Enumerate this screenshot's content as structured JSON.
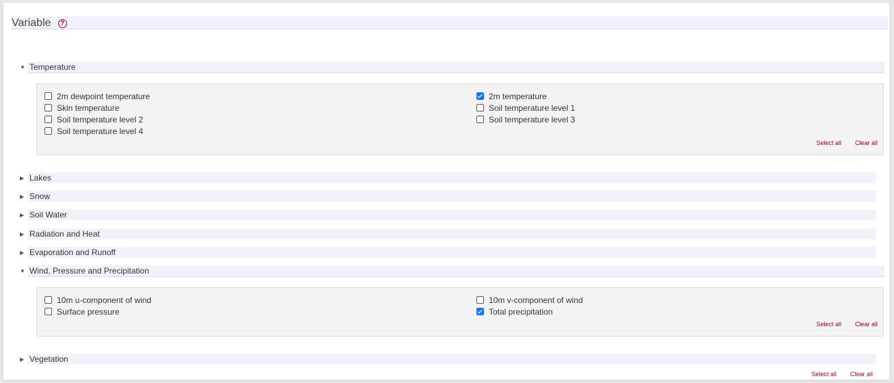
{
  "variable": {
    "title": "Variable",
    "help_icon": "?"
  },
  "sections": [
    {
      "label": "Temperature",
      "expanded": true,
      "options": [
        {
          "label": "2m dewpoint temperature",
          "checked": false
        },
        {
          "label": "2m temperature",
          "checked": true
        },
        {
          "label": "Skin temperature",
          "checked": false
        },
        {
          "label": "Soil temperature level 1",
          "checked": false
        },
        {
          "label": "Soil temperature level 2",
          "checked": false
        },
        {
          "label": "Soil temperature level 3",
          "checked": false
        },
        {
          "label": "Soil temperature level 4",
          "checked": false
        }
      ],
      "select_all": "Select all",
      "clear_all": "Clear all"
    },
    {
      "label": "Lakes",
      "expanded": false
    },
    {
      "label": "Snow",
      "expanded": false
    },
    {
      "label": "Soil Water",
      "expanded": false
    },
    {
      "label": "Radiation and Heat",
      "expanded": false
    },
    {
      "label": "Evaporation and Runoff",
      "expanded": false
    },
    {
      "label": "Wind, Pressure and Precipitation",
      "expanded": true,
      "options": [
        {
          "label": "10m u-component of wind",
          "checked": false
        },
        {
          "label": "10m v-component of wind",
          "checked": false
        },
        {
          "label": "Surface pressure",
          "checked": false
        },
        {
          "label": "Total precipitation",
          "checked": true
        }
      ],
      "select_all": "Select all",
      "clear_all": "Clear all"
    },
    {
      "label": "Vegetation",
      "expanded": false
    }
  ],
  "footer": {
    "select_all": "Select all",
    "clear_all": "Clear all"
  },
  "colors": {
    "accent": "#a0001b",
    "checkbox": "#1a73e8",
    "header_bg": "#f1f1fb"
  },
  "icons": {
    "expanded": "caret-down-icon",
    "collapsed": "caret-right-icon",
    "help": "help-icon"
  }
}
